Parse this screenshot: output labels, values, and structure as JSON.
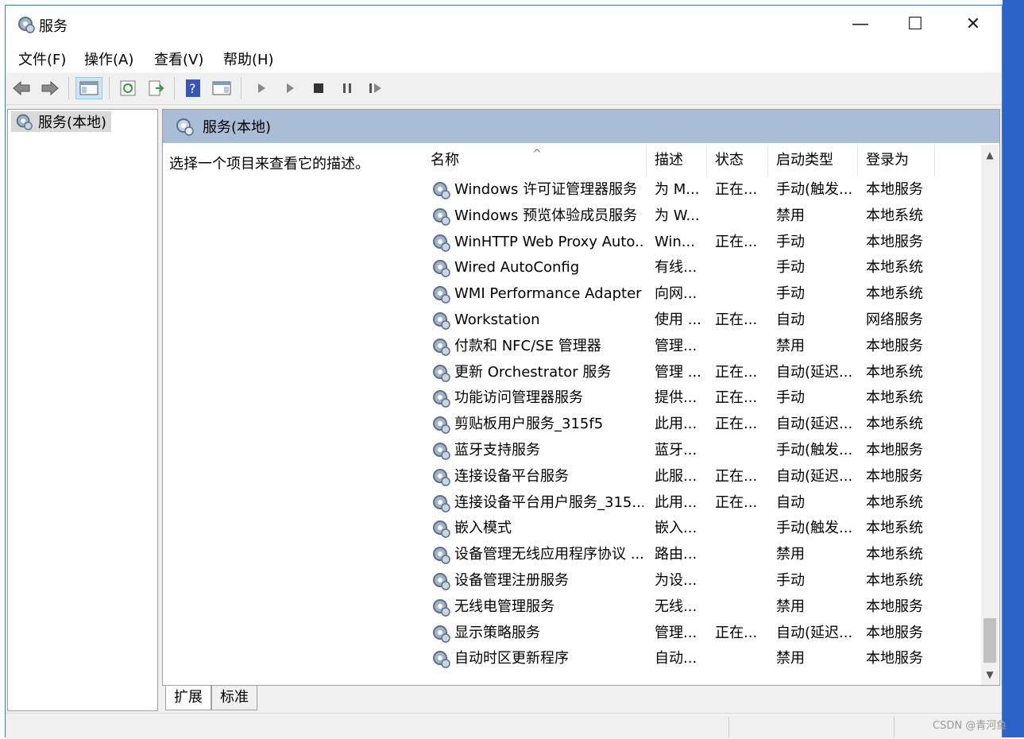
{
  "window": {
    "title": "服务"
  },
  "menu": [
    "文件(F)",
    "操作(A)",
    "查看(V)",
    "帮助(H)"
  ],
  "tree": {
    "item": "服务(本地)"
  },
  "main": {
    "header": "服务(本地)",
    "description": "选择一个项目来查看它的描述。"
  },
  "columns": [
    "名称",
    "描述",
    "状态",
    "启动类型",
    "登录为"
  ],
  "rows": [
    {
      "name": "Windows 许可证管理器服务",
      "desc": "为 M...",
      "status": "正在...",
      "startup": "手动(触发...",
      "logon": "本地服务"
    },
    {
      "name": "Windows 预览体验成员服务",
      "desc": "为 W...",
      "status": "",
      "startup": "禁用",
      "logon": "本地系统"
    },
    {
      "name": "WinHTTP Web Proxy Auto...",
      "desc": "Win...",
      "status": "正在...",
      "startup": "手动",
      "logon": "本地服务"
    },
    {
      "name": "Wired AutoConfig",
      "desc": "有线...",
      "status": "",
      "startup": "手动",
      "logon": "本地系统"
    },
    {
      "name": "WMI Performance Adapter",
      "desc": "向网...",
      "status": "",
      "startup": "手动",
      "logon": "本地系统"
    },
    {
      "name": "Workstation",
      "desc": "使用 ...",
      "status": "正在...",
      "startup": "自动",
      "logon": "网络服务"
    },
    {
      "name": "付款和 NFC/SE 管理器",
      "desc": "管理...",
      "status": "",
      "startup": "禁用",
      "logon": "本地服务"
    },
    {
      "name": "更新 Orchestrator 服务",
      "desc": "管理 ...",
      "status": "正在...",
      "startup": "自动(延迟...",
      "logon": "本地系统"
    },
    {
      "name": "功能访问管理器服务",
      "desc": "提供...",
      "status": "正在...",
      "startup": "手动",
      "logon": "本地系统"
    },
    {
      "name": "剪贴板用户服务_315f5",
      "desc": "此用...",
      "status": "正在...",
      "startup": "自动(延迟...",
      "logon": "本地系统"
    },
    {
      "name": "蓝牙支持服务",
      "desc": "蓝牙...",
      "status": "",
      "startup": "手动(触发...",
      "logon": "本地服务"
    },
    {
      "name": "连接设备平台服务",
      "desc": "此服...",
      "status": "正在...",
      "startup": "自动(延迟...",
      "logon": "本地服务"
    },
    {
      "name": "连接设备平台用户服务_315...",
      "desc": "此用...",
      "status": "正在...",
      "startup": "自动",
      "logon": "本地系统"
    },
    {
      "name": "嵌入模式",
      "desc": "嵌入...",
      "status": "",
      "startup": "手动(触发...",
      "logon": "本地系统"
    },
    {
      "name": "设备管理无线应用程序协议 ...",
      "desc": "路由...",
      "status": "",
      "startup": "禁用",
      "logon": "本地系统"
    },
    {
      "name": "设备管理注册服务",
      "desc": "为设...",
      "status": "",
      "startup": "手动",
      "logon": "本地系统"
    },
    {
      "name": "无线电管理服务",
      "desc": "无线...",
      "status": "",
      "startup": "禁用",
      "logon": "本地服务"
    },
    {
      "name": "显示策略服务",
      "desc": "管理...",
      "status": "正在...",
      "startup": "自动(延迟...",
      "logon": "本地服务"
    },
    {
      "name": "自动时区更新程序",
      "desc": "自动...",
      "status": "",
      "startup": "禁用",
      "logon": "本地服务"
    }
  ],
  "tabs": [
    "扩展",
    "标准"
  ],
  "watermark": "CSDN @青河鱼",
  "colors": {
    "header_bar": "#a9bdd6",
    "window_border": "#3a7bd5",
    "desktop": "#2c63c8"
  }
}
